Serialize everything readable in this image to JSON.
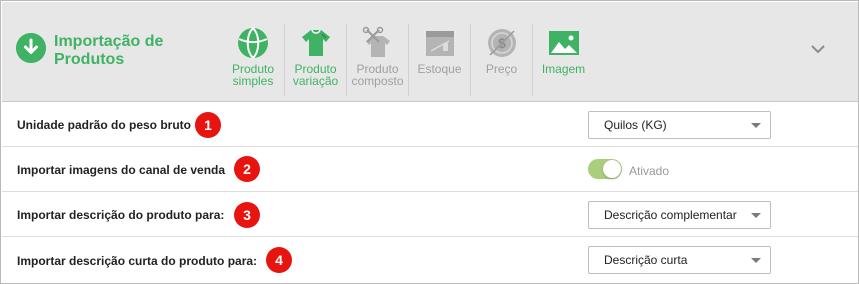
{
  "header": {
    "title": "Importação de Produtos",
    "toolbar": [
      {
        "label": "Produto simples",
        "icon": "simple-product-icon",
        "enabled": true
      },
      {
        "label": "Produto variação",
        "icon": "variation-product-icon",
        "enabled": true
      },
      {
        "label": "Produto composto",
        "icon": "composite-product-icon",
        "enabled": false
      },
      {
        "label": "Estoque",
        "icon": "stock-icon",
        "enabled": false
      },
      {
        "label": "Preço",
        "icon": "price-icon",
        "enabled": false
      },
      {
        "label": "Imagem",
        "icon": "image-icon",
        "enabled": true
      }
    ]
  },
  "settings": [
    {
      "label": "Unidade padrão do peso bruto",
      "badge": "1",
      "control": "select",
      "value": "Quilos (KG)"
    },
    {
      "label": "Importar imagens do canal de venda",
      "badge": "2",
      "control": "toggle",
      "value": "Ativado",
      "on": true
    },
    {
      "label": "Importar descrição do produto para:",
      "badge": "3",
      "control": "select",
      "value": "Descrição complementar"
    },
    {
      "label": "Importar descrição curta do produto para:",
      "badge": "4",
      "control": "select",
      "value": "Descrição curta"
    }
  ],
  "colors": {
    "accent": "#3fb363",
    "badge": "#e8140f",
    "toggle_on": "#a9cf7d",
    "disabled": "#a0a0a0",
    "header_bg": "#e7e7e7"
  }
}
